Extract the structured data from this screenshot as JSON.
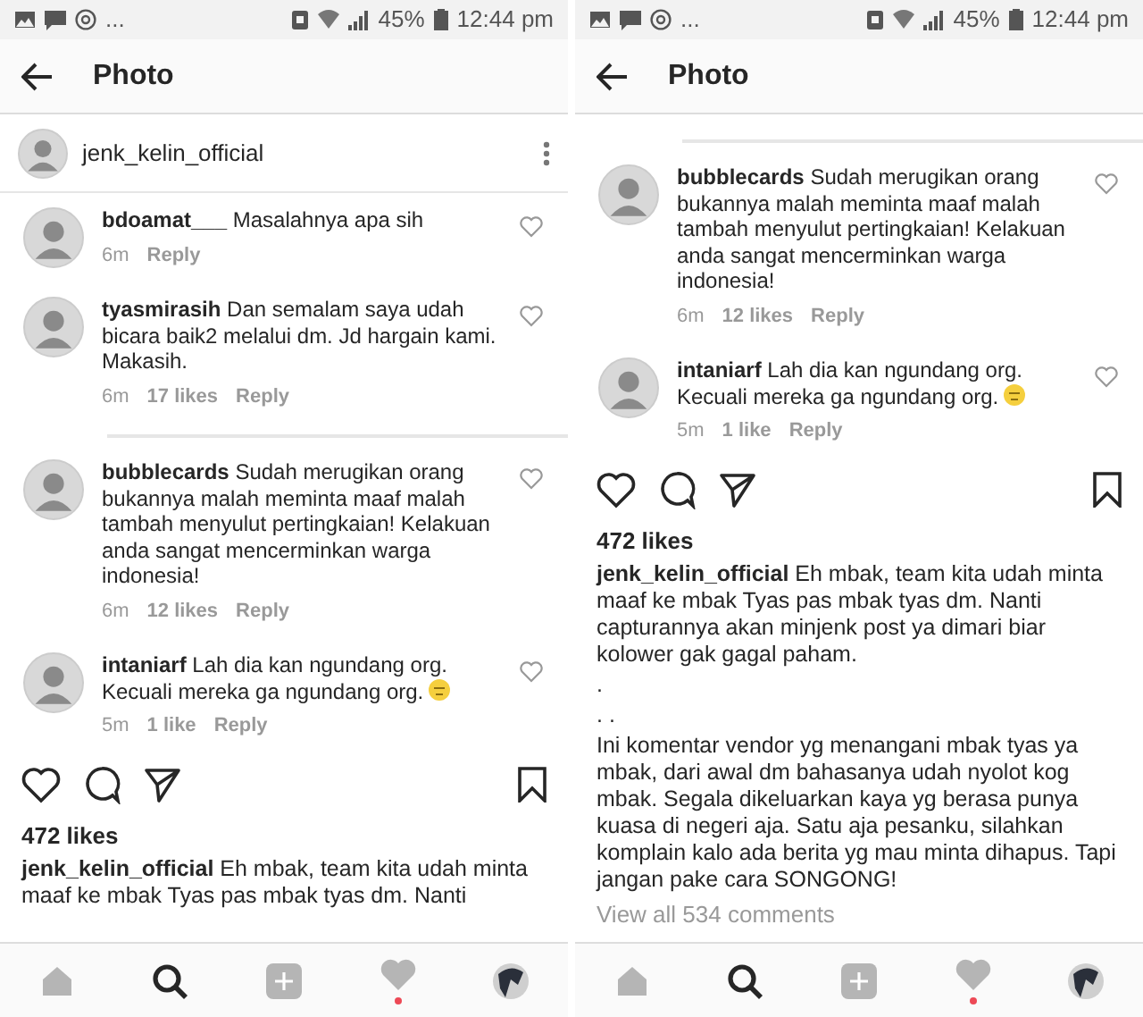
{
  "panels": [
    {
      "status_bar": {
        "more": "...",
        "battery": "45%",
        "time": "12:44 pm"
      },
      "header": {
        "title": "Photo"
      },
      "post_header": {
        "user": "jenk_kelin_official"
      },
      "comments": [
        {
          "user": "bdoamat___",
          "text": "Masalahnya apa sih",
          "time": "6m",
          "reply": "Reply"
        },
        {
          "user": "tyasmirasih",
          "text": "Dan semalam saya udah bicara baik2 melalui dm. Jd hargain kami. Makasih.",
          "time": "6m",
          "likes": "17 likes",
          "reply": "Reply"
        },
        {
          "user": "bubblecards",
          "text": "Sudah merugikan orang bukannya malah meminta maaf malah tambah menyulut pertingkaian! Kelakuan anda sangat mencerminkan warga indonesia!",
          "time": "6m",
          "likes": "12 likes",
          "reply": "Reply",
          "divider_before": true
        },
        {
          "user": "intaniarf",
          "text": "Lah dia kan ngundang org. Kecuali mereka ga ngundang org.",
          "time": "5m",
          "likes": "1 like",
          "reply": "Reply",
          "emoji": true
        }
      ],
      "likes": "472 likes",
      "caption": {
        "user": "jenk_kelin_official",
        "paragraphs": [
          "Eh mbak, team kita udah minta maaf ke mbak Tyas pas mbak tyas dm. Nanti"
        ]
      },
      "nav": [
        {
          "kind": "home",
          "selected": false
        },
        {
          "kind": "search",
          "selected": true
        },
        {
          "kind": "add",
          "selected": false
        },
        {
          "kind": "activity",
          "selected": false,
          "notification": true
        },
        {
          "kind": "profile",
          "selected": false
        }
      ]
    },
    {
      "status_bar": {
        "more": "...",
        "battery": "45%",
        "time": "12:44 pm"
      },
      "header": {
        "title": "Photo"
      },
      "comments": [
        {
          "user": "bubblecards",
          "text": "Sudah merugikan orang bukannya malah meminta maaf malah tambah menyulut pertingkaian! Kelakuan anda sangat mencerminkan warga indonesia!",
          "time": "6m",
          "likes": "12 likes",
          "reply": "Reply",
          "divider_before": true
        },
        {
          "user": "intaniarf",
          "text": "Lah dia kan ngundang org. Kecuali mereka ga ngundang org.",
          "time": "5m",
          "likes": "1 like",
          "reply": "Reply",
          "emoji": true
        }
      ],
      "likes": "472 likes",
      "caption": {
        "user": "jenk_kelin_official",
        "paragraphs": [
          "Eh mbak, team kita udah minta maaf ke mbak Tyas pas mbak tyas dm. Nanti capturannya akan minjenk post ya dimari biar kolower gak gagal paham.",
          ".",
          ". .",
          "Ini komentar vendor yg menangani mbak tyas ya mbak, dari awal dm bahasanya udah nyolot kog mbak. Segala dikeluarkan kaya yg berasa punya kuasa di negeri aja. Satu aja pesanku, silahkan komplain kalo ada berita yg mau minta dihapus. Tapi jangan pake cara SONGONG!"
        ]
      },
      "view_all": "View all 534 comments",
      "nav": [
        {
          "kind": "home",
          "selected": false
        },
        {
          "kind": "search",
          "selected": true
        },
        {
          "kind": "add",
          "selected": false
        },
        {
          "kind": "activity",
          "selected": false,
          "notification": true
        },
        {
          "kind": "profile",
          "selected": false
        }
      ]
    }
  ]
}
